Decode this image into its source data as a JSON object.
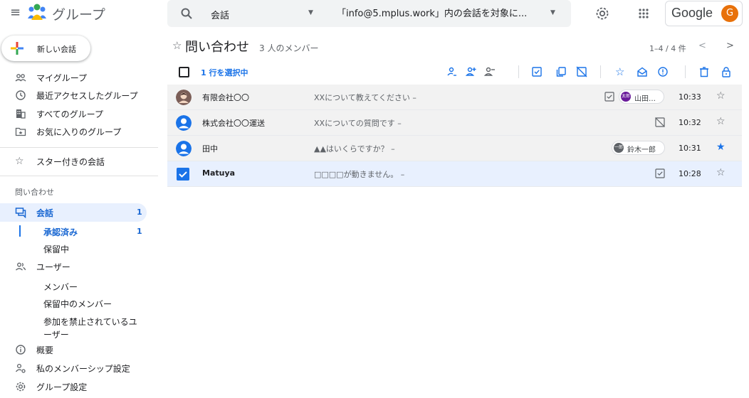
{
  "header": {
    "app_title": "グループ",
    "search_scope": "会話",
    "search_placeholder": "「info@5.mplus.work」内の会話を対象に...",
    "account_brand": "Google",
    "account_initial": "G",
    "logo_colors": [
      "#4285f4",
      "#ea4335",
      "#34a853",
      "#fbbc04"
    ]
  },
  "sidebar": {
    "new_conversation": "新しい会話",
    "items": [
      {
        "label": "マイグループ",
        "icon": "people-icon"
      },
      {
        "label": "最近アクセスしたグループ",
        "icon": "clock-icon"
      },
      {
        "label": "すべてのグループ",
        "icon": "building-icon"
      },
      {
        "label": "お気に入りのグループ",
        "icon": "folder-star-icon"
      }
    ],
    "starred": "スター付きの会話",
    "section": "問い合わせ",
    "conversations": {
      "label": "会話",
      "count": "1"
    },
    "conv_sub": [
      {
        "label": "承認済み",
        "count": "1"
      },
      {
        "label": "保留中"
      }
    ],
    "users": "ユーザー",
    "users_sub": [
      "メンバー",
      "保留中のメンバー",
      "参加を禁止されているユ",
      "ーザー"
    ],
    "about": "概要",
    "membership": "私のメンバーシップ設定",
    "group_settings": "グループ設定"
  },
  "main": {
    "title": "問い合わせ",
    "member_count": "3 人のメンバー",
    "pagination": "1–4 / 4 件",
    "selected_text": "1 行を選択中",
    "rows": [
      {
        "sender": "有限会社〇〇",
        "subject": "XXについて教えてください –",
        "time": "10:33",
        "chip_name": "山田…",
        "chip_avatar": "太郎",
        "starred": false
      },
      {
        "sender": "株式会社〇〇運送",
        "subject": "XXについての質問です –",
        "time": "10:32",
        "starred": false
      },
      {
        "sender": "田中",
        "subject": "▲▲はいくらですか？ –",
        "time": "10:31",
        "chip_name": "鈴木一郎",
        "chip_avatar": "一郎",
        "starred": true
      },
      {
        "sender": "Matuya",
        "subject": "□□□□が動きません。 –",
        "time": "10:28",
        "starred": false
      }
    ]
  },
  "colors": {
    "accent": "#1a73e8",
    "selected_row": "#e8f0fe",
    "read_row": "#f2f2f2"
  }
}
